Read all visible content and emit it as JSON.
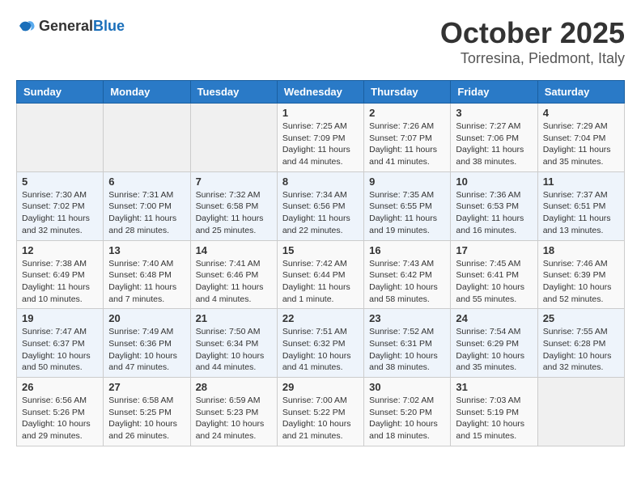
{
  "logo": {
    "general": "General",
    "blue": "Blue"
  },
  "title": "October 2025",
  "location": "Torresina, Piedmont, Italy",
  "weekdays": [
    "Sunday",
    "Monday",
    "Tuesday",
    "Wednesday",
    "Thursday",
    "Friday",
    "Saturday"
  ],
  "weeks": [
    [
      {
        "day": "",
        "info": ""
      },
      {
        "day": "",
        "info": ""
      },
      {
        "day": "",
        "info": ""
      },
      {
        "day": "1",
        "info": "Sunrise: 7:25 AM\nSunset: 7:09 PM\nDaylight: 11 hours and 44 minutes."
      },
      {
        "day": "2",
        "info": "Sunrise: 7:26 AM\nSunset: 7:07 PM\nDaylight: 11 hours and 41 minutes."
      },
      {
        "day": "3",
        "info": "Sunrise: 7:27 AM\nSunset: 7:06 PM\nDaylight: 11 hours and 38 minutes."
      },
      {
        "day": "4",
        "info": "Sunrise: 7:29 AM\nSunset: 7:04 PM\nDaylight: 11 hours and 35 minutes."
      }
    ],
    [
      {
        "day": "5",
        "info": "Sunrise: 7:30 AM\nSunset: 7:02 PM\nDaylight: 11 hours and 32 minutes."
      },
      {
        "day": "6",
        "info": "Sunrise: 7:31 AM\nSunset: 7:00 PM\nDaylight: 11 hours and 28 minutes."
      },
      {
        "day": "7",
        "info": "Sunrise: 7:32 AM\nSunset: 6:58 PM\nDaylight: 11 hours and 25 minutes."
      },
      {
        "day": "8",
        "info": "Sunrise: 7:34 AM\nSunset: 6:56 PM\nDaylight: 11 hours and 22 minutes."
      },
      {
        "day": "9",
        "info": "Sunrise: 7:35 AM\nSunset: 6:55 PM\nDaylight: 11 hours and 19 minutes."
      },
      {
        "day": "10",
        "info": "Sunrise: 7:36 AM\nSunset: 6:53 PM\nDaylight: 11 hours and 16 minutes."
      },
      {
        "day": "11",
        "info": "Sunrise: 7:37 AM\nSunset: 6:51 PM\nDaylight: 11 hours and 13 minutes."
      }
    ],
    [
      {
        "day": "12",
        "info": "Sunrise: 7:38 AM\nSunset: 6:49 PM\nDaylight: 11 hours and 10 minutes."
      },
      {
        "day": "13",
        "info": "Sunrise: 7:40 AM\nSunset: 6:48 PM\nDaylight: 11 hours and 7 minutes."
      },
      {
        "day": "14",
        "info": "Sunrise: 7:41 AM\nSunset: 6:46 PM\nDaylight: 11 hours and 4 minutes."
      },
      {
        "day": "15",
        "info": "Sunrise: 7:42 AM\nSunset: 6:44 PM\nDaylight: 11 hours and 1 minute."
      },
      {
        "day": "16",
        "info": "Sunrise: 7:43 AM\nSunset: 6:42 PM\nDaylight: 10 hours and 58 minutes."
      },
      {
        "day": "17",
        "info": "Sunrise: 7:45 AM\nSunset: 6:41 PM\nDaylight: 10 hours and 55 minutes."
      },
      {
        "day": "18",
        "info": "Sunrise: 7:46 AM\nSunset: 6:39 PM\nDaylight: 10 hours and 52 minutes."
      }
    ],
    [
      {
        "day": "19",
        "info": "Sunrise: 7:47 AM\nSunset: 6:37 PM\nDaylight: 10 hours and 50 minutes."
      },
      {
        "day": "20",
        "info": "Sunrise: 7:49 AM\nSunset: 6:36 PM\nDaylight: 10 hours and 47 minutes."
      },
      {
        "day": "21",
        "info": "Sunrise: 7:50 AM\nSunset: 6:34 PM\nDaylight: 10 hours and 44 minutes."
      },
      {
        "day": "22",
        "info": "Sunrise: 7:51 AM\nSunset: 6:32 PM\nDaylight: 10 hours and 41 minutes."
      },
      {
        "day": "23",
        "info": "Sunrise: 7:52 AM\nSunset: 6:31 PM\nDaylight: 10 hours and 38 minutes."
      },
      {
        "day": "24",
        "info": "Sunrise: 7:54 AM\nSunset: 6:29 PM\nDaylight: 10 hours and 35 minutes."
      },
      {
        "day": "25",
        "info": "Sunrise: 7:55 AM\nSunset: 6:28 PM\nDaylight: 10 hours and 32 minutes."
      }
    ],
    [
      {
        "day": "26",
        "info": "Sunrise: 6:56 AM\nSunset: 5:26 PM\nDaylight: 10 hours and 29 minutes."
      },
      {
        "day": "27",
        "info": "Sunrise: 6:58 AM\nSunset: 5:25 PM\nDaylight: 10 hours and 26 minutes."
      },
      {
        "day": "28",
        "info": "Sunrise: 6:59 AM\nSunset: 5:23 PM\nDaylight: 10 hours and 24 minutes."
      },
      {
        "day": "29",
        "info": "Sunrise: 7:00 AM\nSunset: 5:22 PM\nDaylight: 10 hours and 21 minutes."
      },
      {
        "day": "30",
        "info": "Sunrise: 7:02 AM\nSunset: 5:20 PM\nDaylight: 10 hours and 18 minutes."
      },
      {
        "day": "31",
        "info": "Sunrise: 7:03 AM\nSunset: 5:19 PM\nDaylight: 10 hours and 15 minutes."
      },
      {
        "day": "",
        "info": ""
      }
    ]
  ]
}
